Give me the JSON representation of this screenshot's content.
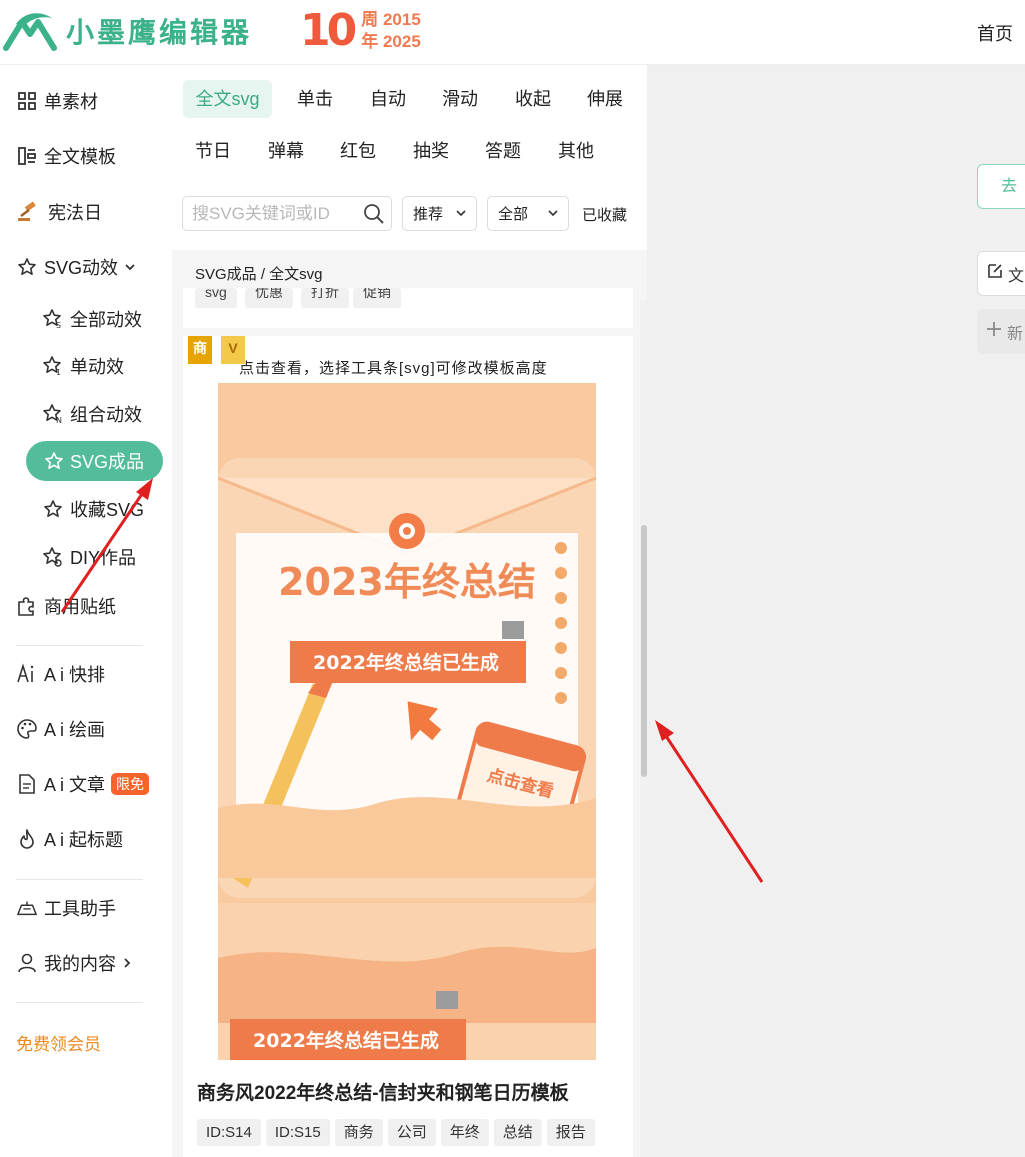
{
  "header": {
    "logo_text": "小墨鹰编辑器",
    "anniversary_number": "10",
    "anniversary_line1": "周 2015",
    "anniversary_line2": "年 2025",
    "nav_home": "首页"
  },
  "sidebar": {
    "items": [
      {
        "label": "单素材",
        "icon": "grid-icon"
      },
      {
        "label": "全文模板",
        "icon": "layout-icon"
      },
      {
        "label": "宪法日",
        "icon": "gavel-icon"
      },
      {
        "label": "SVG动效",
        "icon": "star-icon"
      },
      {
        "label": "全部动效",
        "icon": "star-s-icon"
      },
      {
        "label": "单动效",
        "icon": "star-1-icon"
      },
      {
        "label": "组合动效",
        "icon": "star-n-icon"
      },
      {
        "label": "SVG成品",
        "icon": "star-icon"
      },
      {
        "label": "收藏SVG",
        "icon": "star-icon"
      },
      {
        "label": "DIY作品",
        "icon": "star-gear-icon"
      },
      {
        "label": "商用贴纸",
        "icon": "puzzle-icon"
      },
      {
        "label": "A i 快排",
        "icon": "ai-icon"
      },
      {
        "label": "A i 绘画",
        "icon": "palette-icon"
      },
      {
        "label": "A i 文章",
        "icon": "document-icon"
      },
      {
        "label": "A i 起标题",
        "icon": "flame-icon"
      },
      {
        "label": "工具助手",
        "icon": "tools-icon"
      },
      {
        "label": "我的内容",
        "icon": "user-icon"
      }
    ],
    "limit_badge": "限免",
    "free_member": "免费领会员"
  },
  "panel": {
    "categories_row1": [
      "全文svg",
      "单击",
      "自动",
      "滑动",
      "收起",
      "伸展"
    ],
    "categories_row2": [
      "节日",
      "弹幕",
      "红包",
      "抽奖",
      "答题",
      "其他"
    ],
    "search_placeholder": "搜SVG关键词或ID",
    "sort_select": "推荐",
    "filter_select": "全部",
    "favorites": "已收藏",
    "breadcrumb": "SVG成品 / 全文svg",
    "prev_tags": [
      "svg",
      "优惠",
      "打折",
      "促销"
    ],
    "card": {
      "badge_commercial": "商",
      "badge_vip": "V",
      "caption": "点击查看，选择工具条[svg]可修改模板高度",
      "thumb_title": "2023年终总结",
      "thumb_banner": "2022年终总结已生成",
      "thumb_button": "点击查看",
      "thumb_banner_bottom": "2022年终总结已生成",
      "title": "商务风2022年终总结-信封夹和钢笔日历模板",
      "tags": [
        "ID:S14",
        "ID:S15",
        "商务",
        "公司",
        "年终",
        "总结",
        "报告"
      ]
    }
  },
  "right": {
    "go_button": "去",
    "doc_button": "文",
    "new_button": "新"
  },
  "colors": {
    "brand": "#3cb28a",
    "active": "#53bd9b",
    "accent_orange": "#f6642c",
    "arrow": "#e02020"
  }
}
